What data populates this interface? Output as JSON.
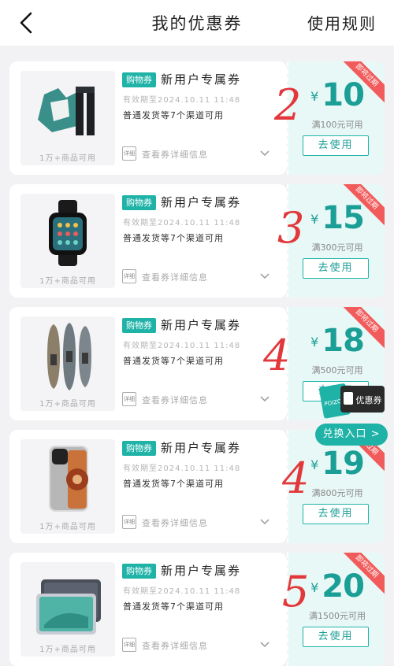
{
  "header": {
    "title": "我的优惠券",
    "rules_label": "使用规则"
  },
  "coupons": [
    {
      "tag": "购物券",
      "title": "新用户专属券",
      "validity": "有效期至2024.10.11 11:48",
      "channel": "普通发货等7个渠道可用",
      "scope": "1万+商品可用",
      "detail_label": "查看券详细信息",
      "detail_icon_label": "详细",
      "ribbon": "即将过期",
      "currency": "¥",
      "amount": "10",
      "threshold": "满100元可用",
      "use_label": "去使用",
      "annotation": "2",
      "product_icon": "jacket-pants-icon"
    },
    {
      "tag": "购物券",
      "title": "新用户专属券",
      "validity": "有效期至2024.10.11 11:48",
      "channel": "普通发货等7个渠道可用",
      "scope": "1万+商品可用",
      "detail_label": "查看券详细信息",
      "detail_icon_label": "详细",
      "ribbon": "即将过期",
      "currency": "¥",
      "amount": "15",
      "threshold": "满300元可用",
      "use_label": "去使用",
      "annotation": "3",
      "product_icon": "smartwatch-icon"
    },
    {
      "tag": "购物券",
      "title": "新用户专属券",
      "validity": "有效期至2024.10.11 11:48",
      "channel": "普通发货等7个渠道可用",
      "scope": "1万+商品可用",
      "detail_label": "查看券详细信息",
      "detail_icon_label": "详细",
      "ribbon": "即将过期",
      "currency": "¥",
      "amount": "18",
      "threshold": "满500元可用",
      "use_label": "去使用",
      "annotation": "4",
      "product_icon": "kayak-icon"
    },
    {
      "tag": "购物券",
      "title": "新用户专属券",
      "validity": "有效期至2024.10.11 11:48",
      "channel": "普通发货等7个渠道可用",
      "scope": "1万+商品可用",
      "detail_label": "查看券详细信息",
      "detail_icon_label": "详细",
      "ribbon": "即将过期",
      "currency": "¥",
      "amount": "19",
      "threshold": "满800元可用",
      "use_label": "去使用",
      "annotation": "4",
      "product_icon": "phone-icon"
    },
    {
      "tag": "购物券",
      "title": "新用户专属券",
      "validity": "有效期至2024.10.11 11:48",
      "channel": "普通发货等7个渠道可用",
      "scope": "1万+商品可用",
      "detail_label": "查看券详细信息",
      "detail_icon_label": "详细",
      "ribbon": "即将过期",
      "currency": "¥",
      "amount": "20",
      "threshold": "满1500元可用",
      "use_label": "去使用",
      "annotation": "5",
      "product_icon": "tablet-icon"
    }
  ],
  "floating": {
    "badge_text": "优惠券",
    "ticket_text": "POIZON",
    "exchange_label": "兑换入口 >"
  },
  "colors": {
    "accent": "#1fb3a8",
    "ribbon": "#f25b5b",
    "annotation": "#e2373b"
  }
}
